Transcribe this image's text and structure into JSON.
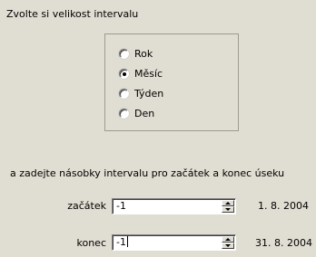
{
  "heading": "Zvolte si velikost intervalu",
  "interval_options": [
    {
      "label": "Rok",
      "checked": false
    },
    {
      "label": "Měsíc",
      "checked": true
    },
    {
      "label": "Týden",
      "checked": false
    },
    {
      "label": "Den",
      "checked": false
    }
  ],
  "instruction": "a zadejte násobky intervalu pro začátek a konec úseku",
  "start": {
    "label": "začátek",
    "value": "-1",
    "date": "1. 8. 2004"
  },
  "end": {
    "label": "konec",
    "value": "-1",
    "date": "31. 8. 2004"
  }
}
